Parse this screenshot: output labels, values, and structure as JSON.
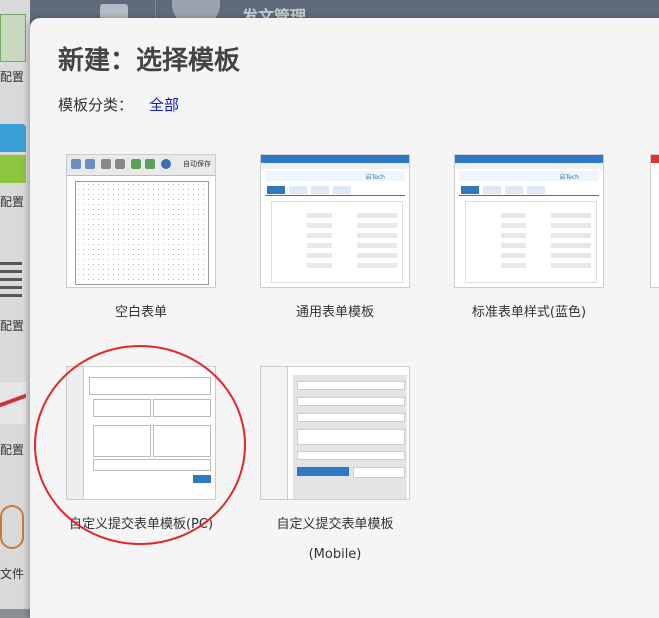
{
  "app": {
    "header_title": "发文管理"
  },
  "sidebar": {
    "items": [
      {
        "label": "配置"
      },
      {
        "label": "配置"
      },
      {
        "label": "配置"
      },
      {
        "label": "配置"
      },
      {
        "label": "文件"
      }
    ]
  },
  "dialog": {
    "title": "新建：选择模板",
    "category_label": "模板分类：",
    "category_value": "全部",
    "templates": [
      {
        "name": "空白表单",
        "icon": "blank-form-thumbnail"
      },
      {
        "name": "通用表单模板",
        "icon": "general-form-thumbnail"
      },
      {
        "name": "标准表单样式(蓝色)",
        "icon": "standard-blue-form-thumbnail"
      },
      {
        "name": "自定义提交表单模板(PC)",
        "icon": "custom-submit-pc-thumbnail"
      },
      {
        "name": "自定义提交表单模板",
        "name_line2": "(Mobile)",
        "icon": "custom-submit-mobile-thumbnail"
      }
    ],
    "thumb_texts": {
      "autosave": "自动保存",
      "brand": "启Tech"
    }
  },
  "colors": {
    "accent": "#2f78c4",
    "link": "#1020c0",
    "highlight_circle": "#e0282b"
  }
}
